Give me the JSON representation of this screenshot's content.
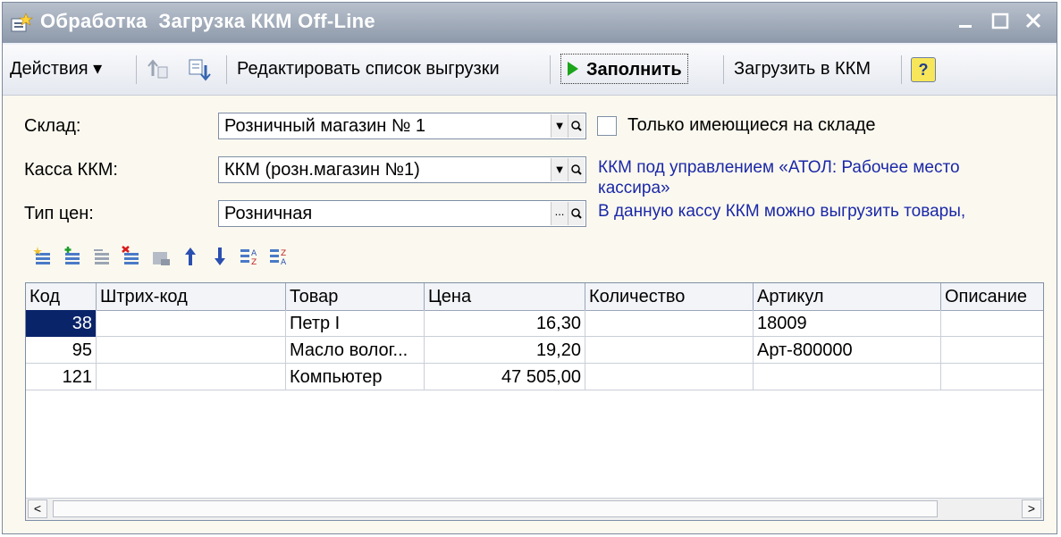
{
  "window": {
    "title": "Обработка  Загрузка ККМ Off-Line"
  },
  "toolbar": {
    "actions_label": "Действия ▾",
    "edit_list_label": "Редактировать список выгрузки",
    "fill_label": "Заполнить",
    "load_label": "Загрузить в ККМ",
    "help_label": "?"
  },
  "form": {
    "warehouse_label": "Склад:",
    "warehouse_value": "Розничный магазин № 1",
    "cash_label": "Касса ККМ:",
    "cash_value": "ККМ (розн.магазин №1)",
    "price_type_label": "Тип цен:",
    "price_type_value": "Розничная",
    "only_in_stock_label": "Только имеющиеся на складе",
    "info_line1": "ККМ под управлением «АТОЛ: Рабочее место",
    "info_line2": "кассира»",
    "info_line3": "В данную кассу ККМ можно выгрузить товары,"
  },
  "grid": {
    "columns": [
      "Код",
      "Штрих-код",
      "Товар",
      "Цена",
      "Количество",
      "Артикул",
      "Описание"
    ],
    "rows": [
      [
        "38",
        "",
        "Петр I",
        "16,30",
        "",
        "18009",
        ""
      ],
      [
        "95",
        "",
        "Масло волог...",
        "19,20",
        "",
        "Арт-800000",
        ""
      ],
      [
        "121",
        "",
        "Компьютер",
        "47 505,00",
        "",
        "",
        ""
      ]
    ]
  },
  "colors": {
    "accent_blue": "#1b28a8",
    "selection": "#0a246a",
    "help_yellow": "#f7e65a"
  }
}
